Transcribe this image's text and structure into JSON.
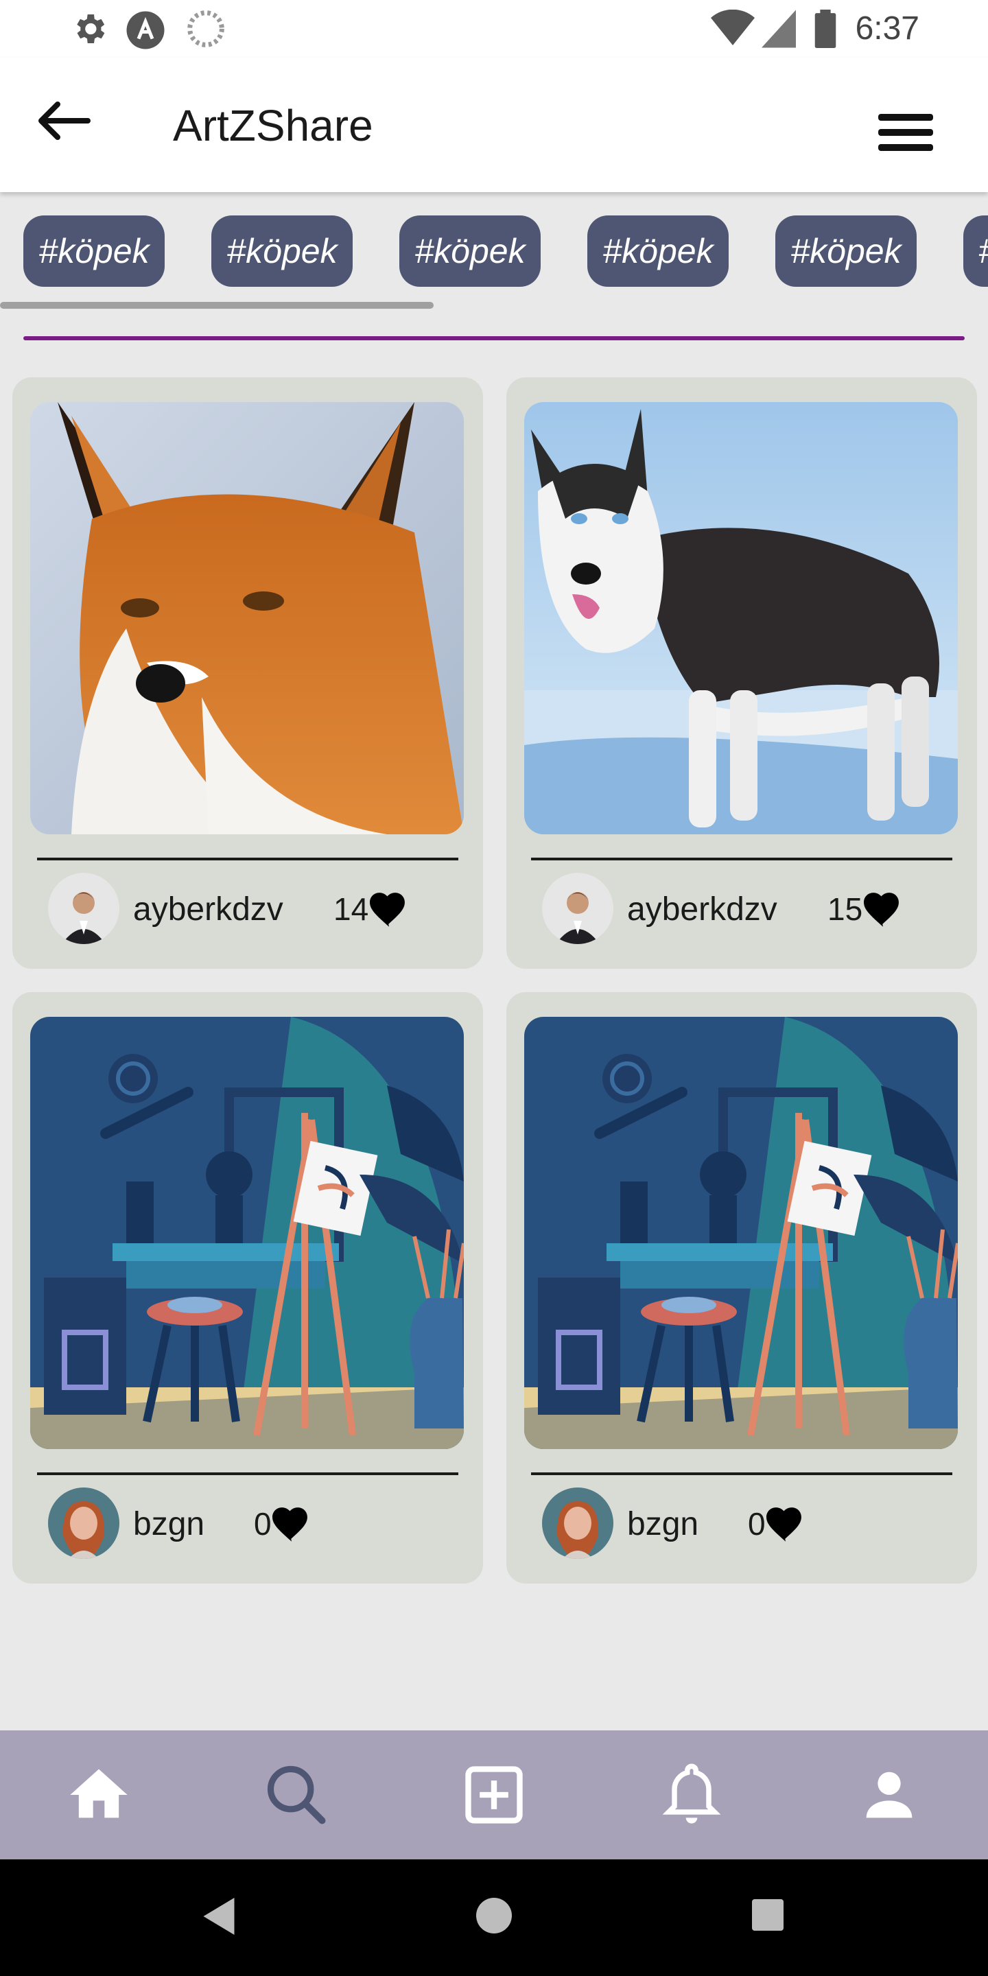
{
  "status_bar": {
    "time": "6:37",
    "left_icons": [
      "gear-icon",
      "a-circle-icon",
      "loading-icon"
    ],
    "right_icons": [
      "wifi-icon",
      "signal-icon",
      "battery-icon"
    ]
  },
  "app_bar": {
    "title": "ArtZShare",
    "back_icon": "arrow-left-icon",
    "menu_icon": "hamburger-menu-icon"
  },
  "tags": [
    "#köpek",
    "#köpek",
    "#köpek",
    "#köpek",
    "#köpek",
    "#"
  ],
  "colors": {
    "tag_bg": "#4f5673",
    "accent_purple": "#7b1b86",
    "card_bg": "#d9dcd5",
    "bottom_nav_bg": "#a7a2b8"
  },
  "posts": [
    {
      "image": "fox-photo",
      "username": "ayberkdzv",
      "likes": "14",
      "avatar": "man-in-suit-avatar"
    },
    {
      "image": "husky-photo",
      "username": "ayberkdzv",
      "likes": "15",
      "avatar": "man-in-suit-avatar"
    },
    {
      "image": "art-studio-illustration",
      "username": "bzgn",
      "likes": "0",
      "avatar": "woman-avatar"
    },
    {
      "image": "art-studio-illustration",
      "username": "bzgn",
      "likes": "0",
      "avatar": "woman-avatar"
    }
  ],
  "bottom_nav": [
    "home-icon",
    "search-icon",
    "add-post-icon",
    "notifications-icon",
    "profile-icon"
  ],
  "system_nav": [
    "back-triangle-icon",
    "home-circle-icon",
    "recents-square-icon"
  ]
}
